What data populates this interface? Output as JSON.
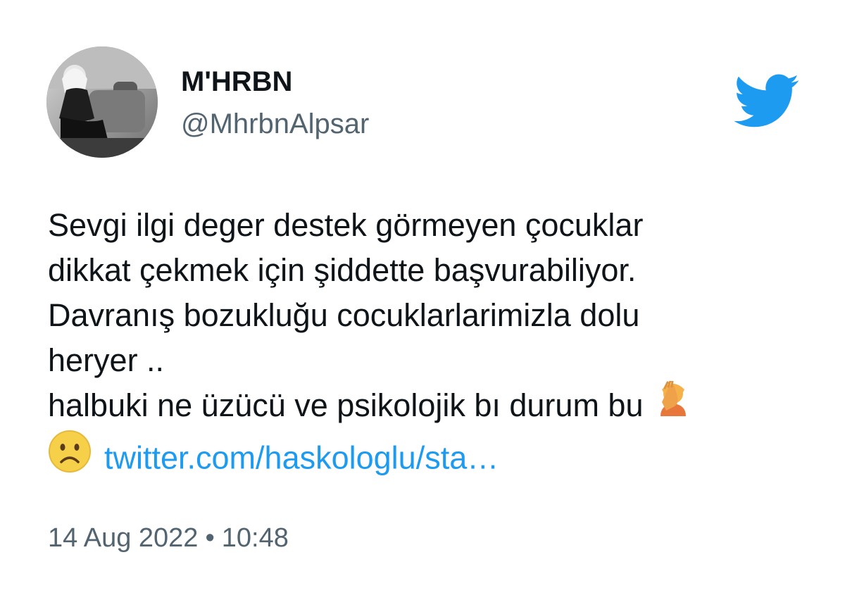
{
  "author": {
    "display_name": "M'HRBN",
    "handle": "@MhrbnAlpsar"
  },
  "brand": {
    "icon": "twitter-bird-icon",
    "color": "#1d9bf0"
  },
  "tweet": {
    "lines": [
      "Sevgi ilgi deger destek görmeyen çocuklar",
      "dikkat çekmek için şiddette başvurabiliyor.",
      "Davranış bozukluğu cocuklarlarimizla dolu",
      "heryer ..",
      "halbuki ne üzücü ve psikolojik bı durum bu"
    ],
    "emoji_after_last_line": "facepalm-emoji",
    "emoji_before_link": "frowning-face-emoji",
    "link_text": "twitter.com/haskologlu/sta…"
  },
  "meta": {
    "date": "14 Aug 2022",
    "separator": "•",
    "time": "10:48"
  },
  "colors": {
    "text": "#0f1419",
    "secondary": "#536471",
    "link": "#1d9bf0"
  }
}
